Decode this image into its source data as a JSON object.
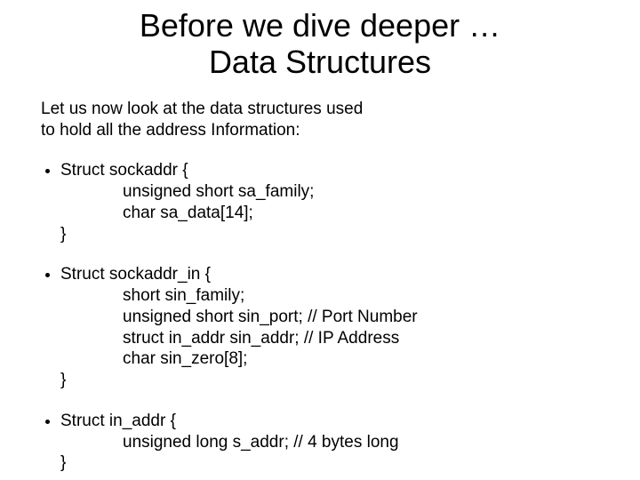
{
  "title_line1": "Before we dive deeper …",
  "title_line2": "Data Structures",
  "intro_line1": "Let us now look at the data structures used",
  "intro_line2": "to hold all the address Information:",
  "structs": [
    {
      "decl": "Struct sockaddr {",
      "members": [
        "unsigned short sa_family;",
        "char sa_data[14];"
      ],
      "close": "}"
    },
    {
      "decl": "Struct sockaddr_in {",
      "members": [
        "short sin_family;",
        "unsigned short sin_port; // Port Number",
        "struct in_addr sin_addr; // IP Address",
        "char sin_zero[8];"
      ],
      "close": "}"
    },
    {
      "decl": "Struct in_addr {",
      "members": [
        "unsigned long s_addr; // 4 bytes long"
      ],
      "close": "}"
    }
  ]
}
